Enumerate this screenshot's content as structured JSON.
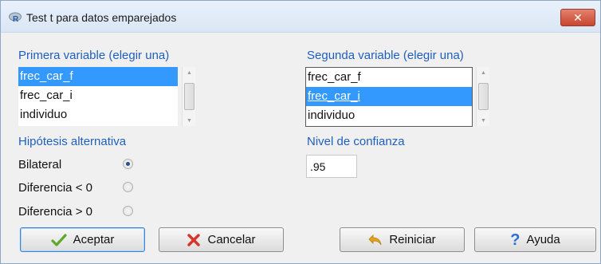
{
  "window": {
    "title": "Test t para datos emparejados",
    "title_icon": "r-logo-icon",
    "close_glyph": "✕"
  },
  "first_variable": {
    "label": "Primera variable (elegir una)",
    "items": [
      "frec_car_f",
      "frec_car_i",
      "individuo"
    ],
    "selected": "frec_car_f"
  },
  "second_variable": {
    "label": "Segunda variable (elegir una)",
    "items": [
      "frec_car_f",
      "frec_car_i",
      "individuo"
    ],
    "selected": "frec_car_i"
  },
  "alternative": {
    "label": "Hipótesis alternativa",
    "options": [
      "Bilateral",
      "Diferencia < 0",
      "Diferencia > 0"
    ],
    "selected": "Bilateral"
  },
  "confidence": {
    "label": "Nivel de confianza",
    "value": ".95"
  },
  "buttons": {
    "accept": "Aceptar",
    "cancel": "Cancelar",
    "reset": "Reiniciar",
    "help": "Ayuda"
  },
  "colors": {
    "section_label": "#1f5fbd",
    "selection": "#3399ff",
    "accept_icon": "#5fa829",
    "cancel_icon": "#d9342b",
    "reset_icon": "#e6a21c",
    "help_icon": "#2d6fd6"
  }
}
